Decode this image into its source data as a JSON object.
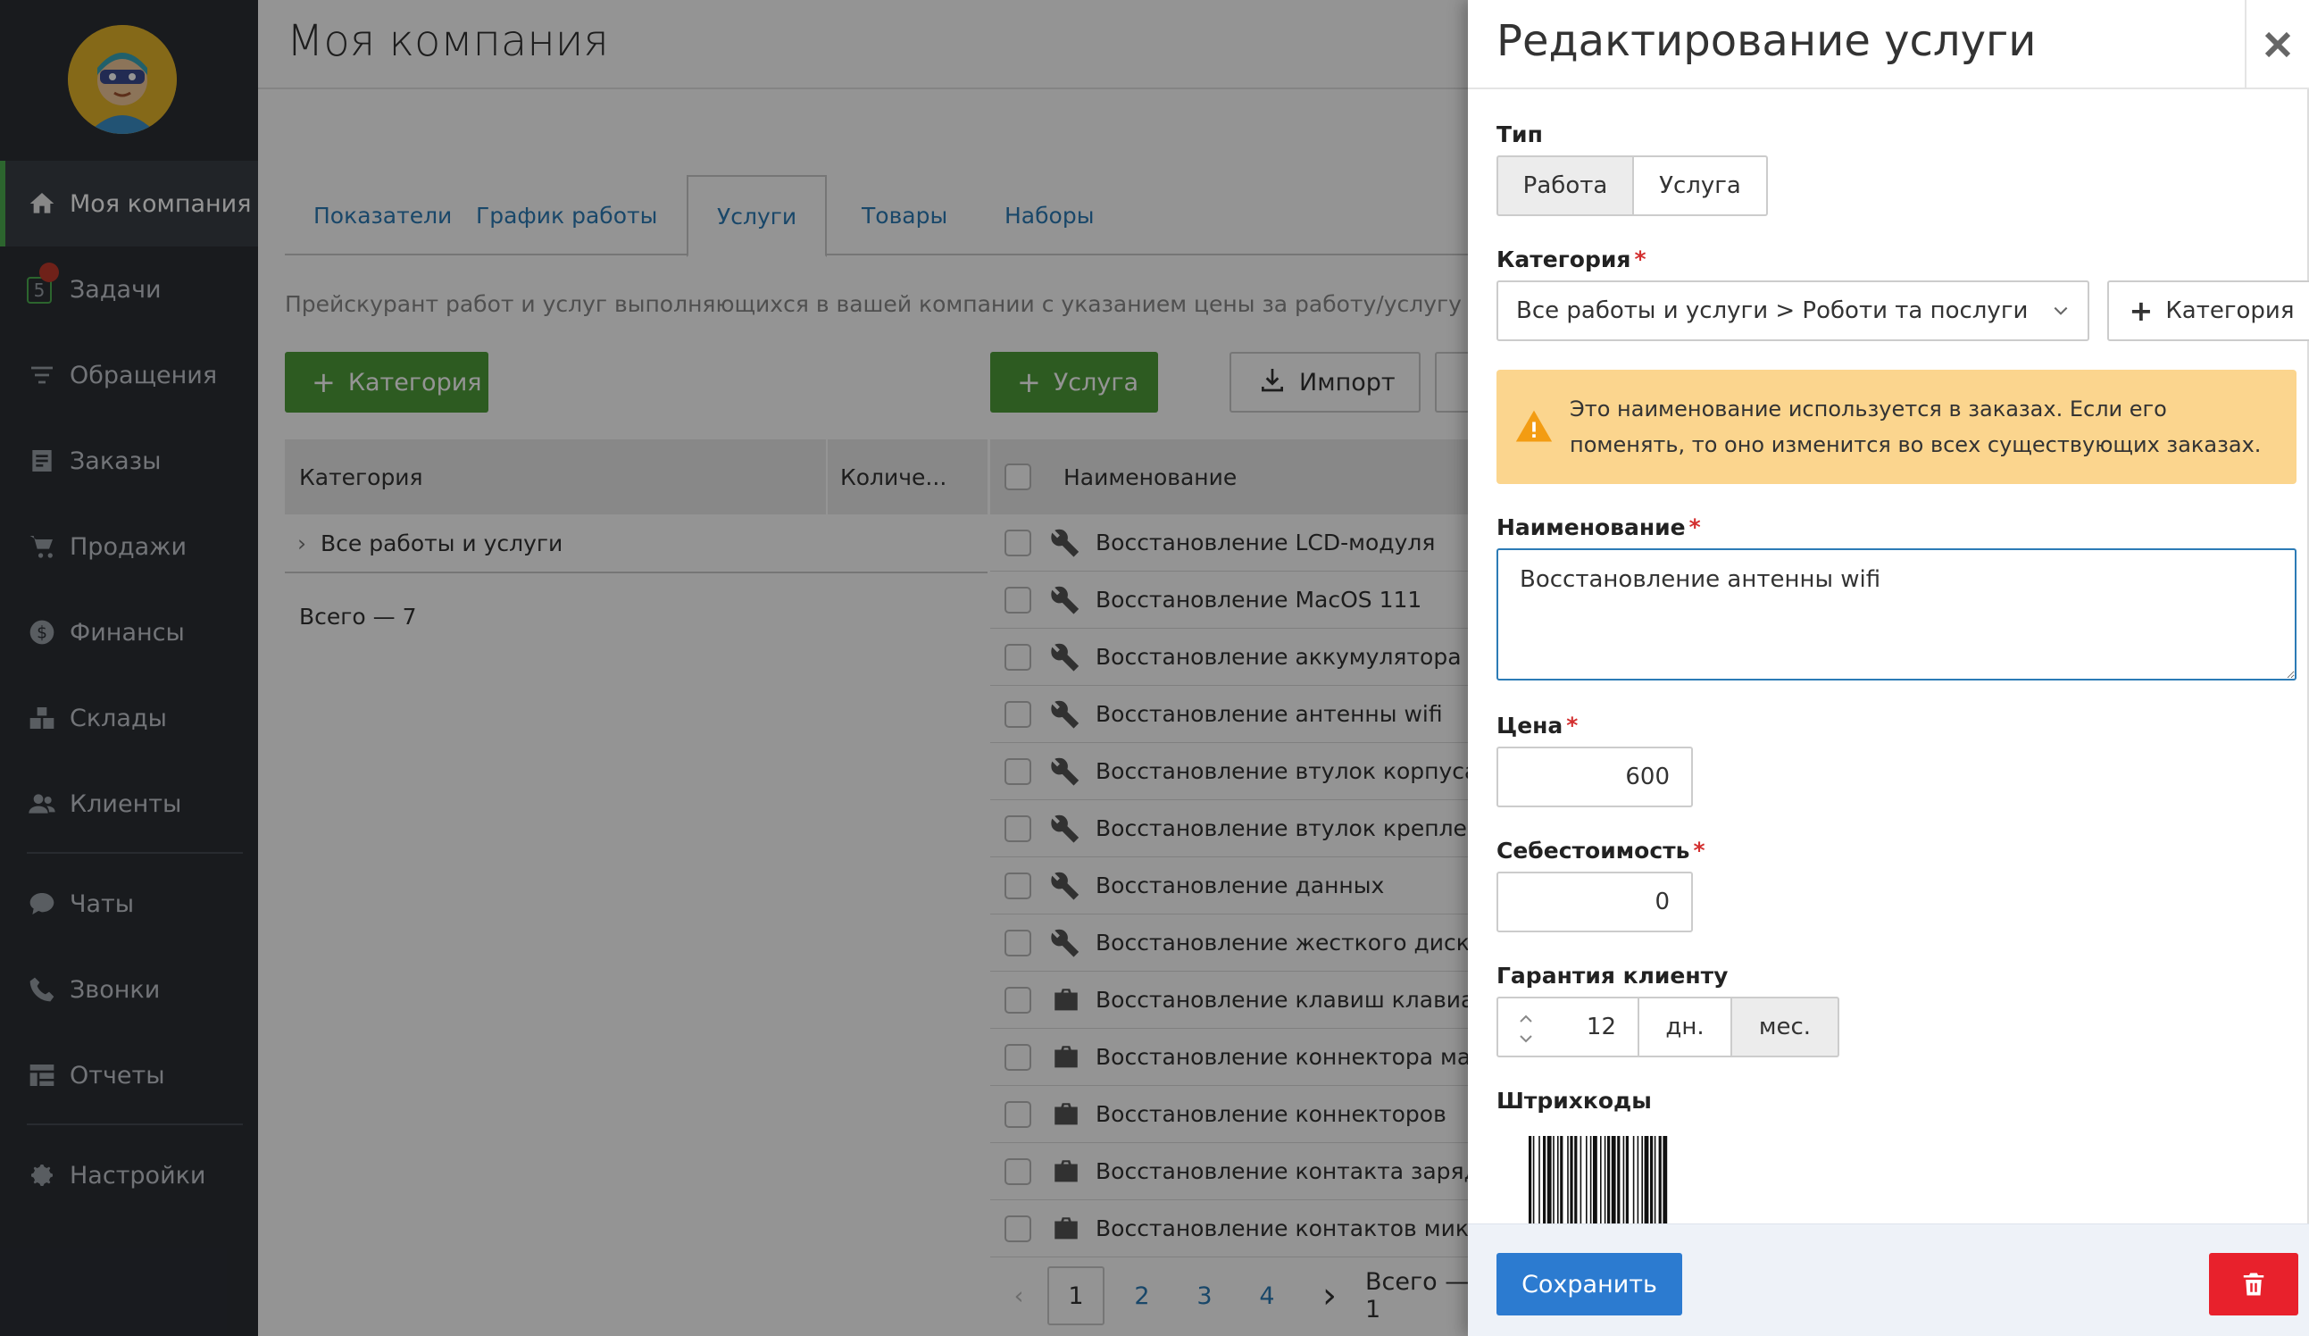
{
  "sidebar": {
    "items": [
      {
        "label": "Моя компания",
        "icon": "home-icon"
      },
      {
        "label": "Задачи",
        "icon": "tasks-icon"
      },
      {
        "label": "Обращения",
        "icon": "filter-icon"
      },
      {
        "label": "Заказы",
        "icon": "orders-icon"
      },
      {
        "label": "Продажи",
        "icon": "cart-icon"
      },
      {
        "label": "Финансы",
        "icon": "dollar-icon"
      },
      {
        "label": "Склады",
        "icon": "boxes-icon"
      },
      {
        "label": "Клиенты",
        "icon": "users-icon"
      },
      {
        "label": "Чаты",
        "icon": "chat-icon"
      },
      {
        "label": "Звонки",
        "icon": "phone-icon"
      },
      {
        "label": "Отчеты",
        "icon": "reports-icon"
      },
      {
        "label": "Настройки",
        "icon": "gear-icon"
      }
    ],
    "tasks_badge": "5"
  },
  "main": {
    "title": "Моя компания",
    "tabs": [
      {
        "label": "Показатели"
      },
      {
        "label": "График работы"
      },
      {
        "label": "Услуги"
      },
      {
        "label": "Товары"
      },
      {
        "label": "Наборы"
      }
    ],
    "description": "Прейскурант работ и услуг выполняющихся в вашей компании с указанием цены за работу/услугу",
    "add_category_label": "Категория",
    "add_service_label": "Услуга",
    "import_label": "Импорт",
    "categories_table": {
      "headers": [
        "Категория",
        "Количе..."
      ],
      "rows": [
        {
          "label": "Все работы и услуги"
        }
      ],
      "total": "Всего — 7"
    },
    "services_table": {
      "header": "Наименование",
      "rows": [
        {
          "name": "Восстановление LCD-модуля",
          "icon": "wrench-icon"
        },
        {
          "name": "Восстановление MacOS 111",
          "icon": "wrench-icon"
        },
        {
          "name": "Восстановление аккумулятора",
          "icon": "wrench-icon"
        },
        {
          "name": "Восстановление антенны wifi",
          "icon": "wrench-icon"
        },
        {
          "name": "Восстановление втулок корпуса",
          "icon": "wrench-icon"
        },
        {
          "name": "Восстановление втулок крепления",
          "icon": "wrench-icon"
        },
        {
          "name": "Восстановление данных",
          "icon": "wrench-icon"
        },
        {
          "name": "Восстановление жесткого диска",
          "icon": "wrench-icon"
        },
        {
          "name": "Восстановление клавиш клавиатур",
          "icon": "briefcase-icon"
        },
        {
          "name": "Восстановление коннектора матри",
          "icon": "briefcase-icon"
        },
        {
          "name": "Восстановление коннекторов",
          "icon": "briefcase-icon"
        },
        {
          "name": "Восстановление контакта зарядно",
          "icon": "briefcase-icon"
        },
        {
          "name": "Восстановление контактов микрос",
          "icon": "briefcase-icon"
        }
      ]
    },
    "pagination": {
      "pages": [
        "1",
        "2",
        "3",
        "4"
      ],
      "current": "1",
      "total": "Всего — 1"
    }
  },
  "drawer": {
    "title": "Редактирование услуги",
    "type_label": "Тип",
    "type_options": [
      "Работа",
      "Услуга"
    ],
    "type_selected": "Работа",
    "category_label": "Категория",
    "category_value": "Все работы и услуги > Роботи та послуги",
    "add_category_label": "Категория",
    "warning_text": "Это наименование используется в заказах. Если его поменять, то оно изменится во всех существующих заказах.",
    "name_label": "Наименование",
    "name_value": "Восстановление антенны wifi",
    "price_label": "Цена",
    "price_value": "600",
    "cost_label": "Себестоимость",
    "cost_value": "0",
    "warranty_label": "Гарантия клиенту",
    "warranty_value": "12",
    "warranty_units": [
      "дн.",
      "мес."
    ],
    "warranty_unit_selected": "мес.",
    "barcodes_label": "Штрихкоды",
    "save_label": "Сохранить",
    "required_mark": "*"
  },
  "colors": {
    "sidebar_bg": "#2b2f35",
    "accent_green": "#4f9d3a",
    "primary_blue": "#2c7bd0",
    "danger_red": "#e8212c",
    "warning_bg": "#fbd58e",
    "link_blue": "#2c7bb6"
  }
}
